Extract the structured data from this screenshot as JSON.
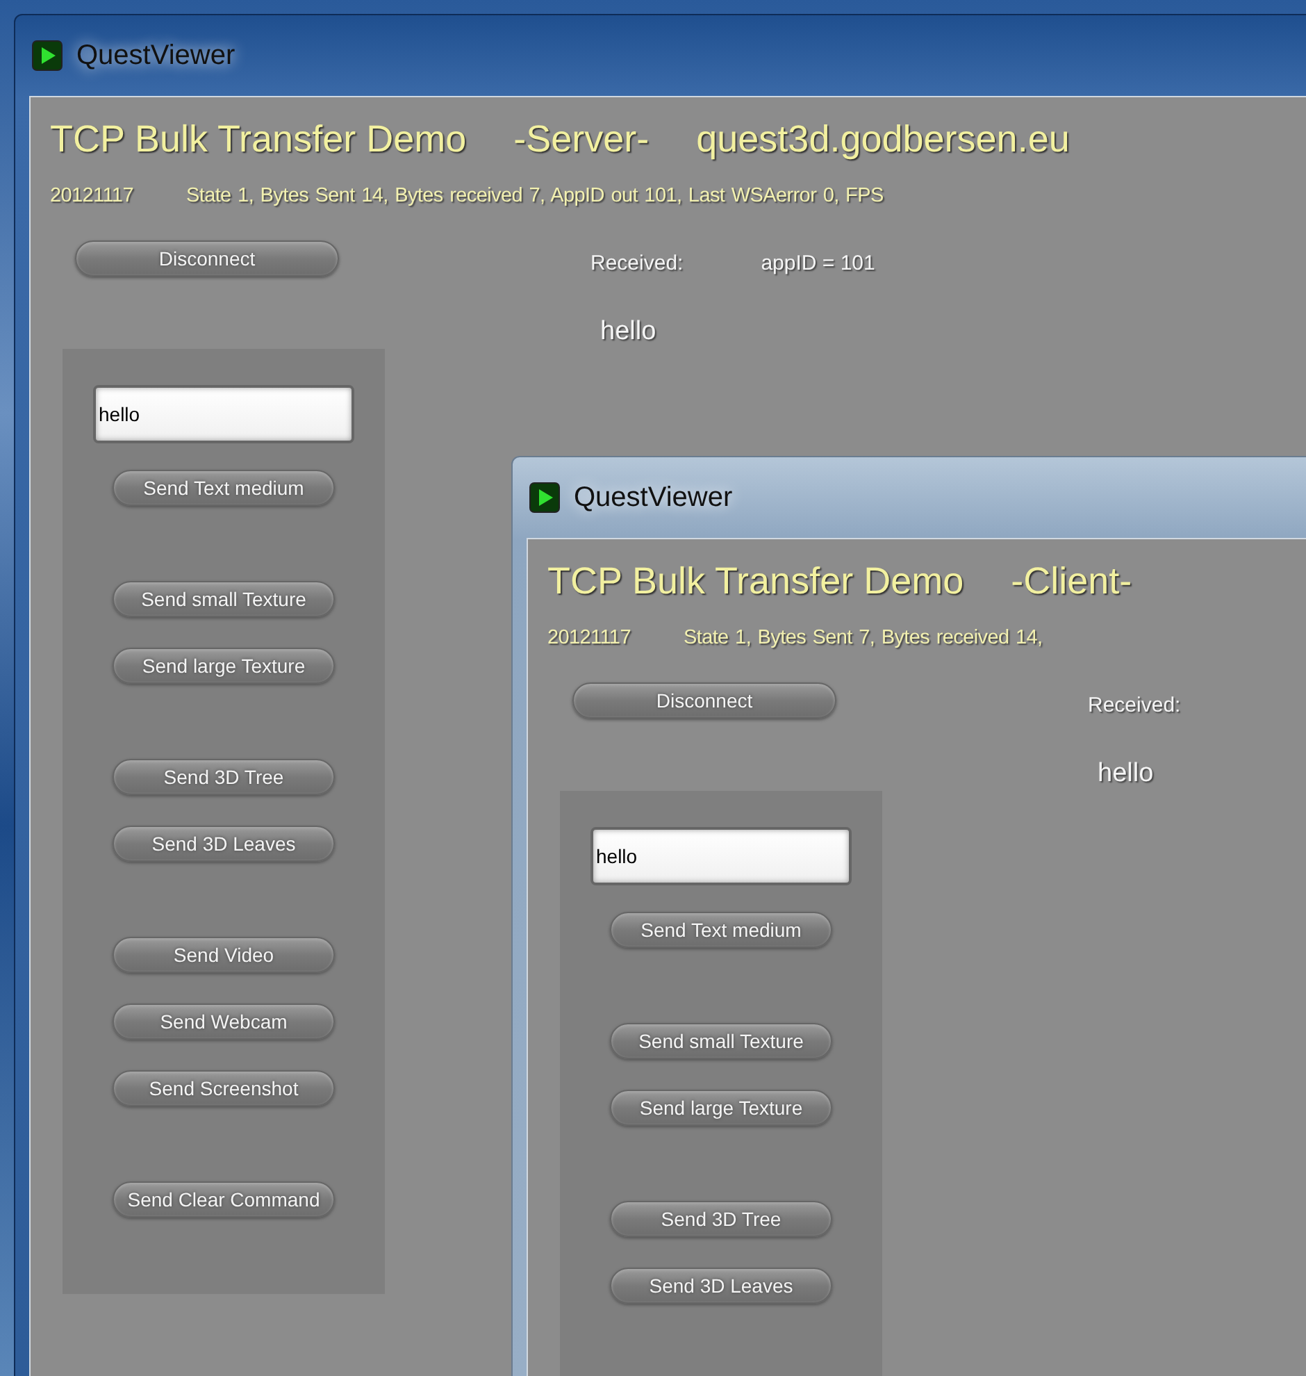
{
  "windows": [
    {
      "title": "QuestViewer",
      "active": true,
      "heading": "TCP Bulk Transfer Demo",
      "role": "-Server-",
      "host": "quest3d.godbersen.eu",
      "date": "20121117",
      "status": "State 1,  Bytes Sent 14, Bytes received 7,   AppID out 101,  Last WSAerror 0,  FPS",
      "disconnect": "Disconnect",
      "received_label": "Received:",
      "received_value": "appID  = 101",
      "message": "hello",
      "input_value": "hello",
      "button_groups": [
        [
          "Send Text medium"
        ],
        [
          "Send small Texture",
          "Send large Texture"
        ],
        [
          "Send 3D Tree",
          "Send 3D Leaves"
        ],
        [
          "Send Video",
          "Send Webcam",
          "Send Screenshot"
        ],
        [
          "Send Clear Command"
        ]
      ]
    },
    {
      "title": "QuestViewer",
      "active": false,
      "heading": "TCP Bulk Transfer Demo",
      "role": "-Client-",
      "date": "20121117",
      "status": "State 1,  Bytes Sent 7, Bytes received 14,",
      "disconnect": "Disconnect",
      "received_label": "Received:",
      "message": "hello",
      "input_value": "hello",
      "button_groups": [
        [
          "Send Text medium"
        ],
        [
          "Send small Texture",
          "Send large Texture"
        ],
        [
          "Send 3D Tree",
          "Send 3D Leaves"
        ]
      ]
    }
  ]
}
